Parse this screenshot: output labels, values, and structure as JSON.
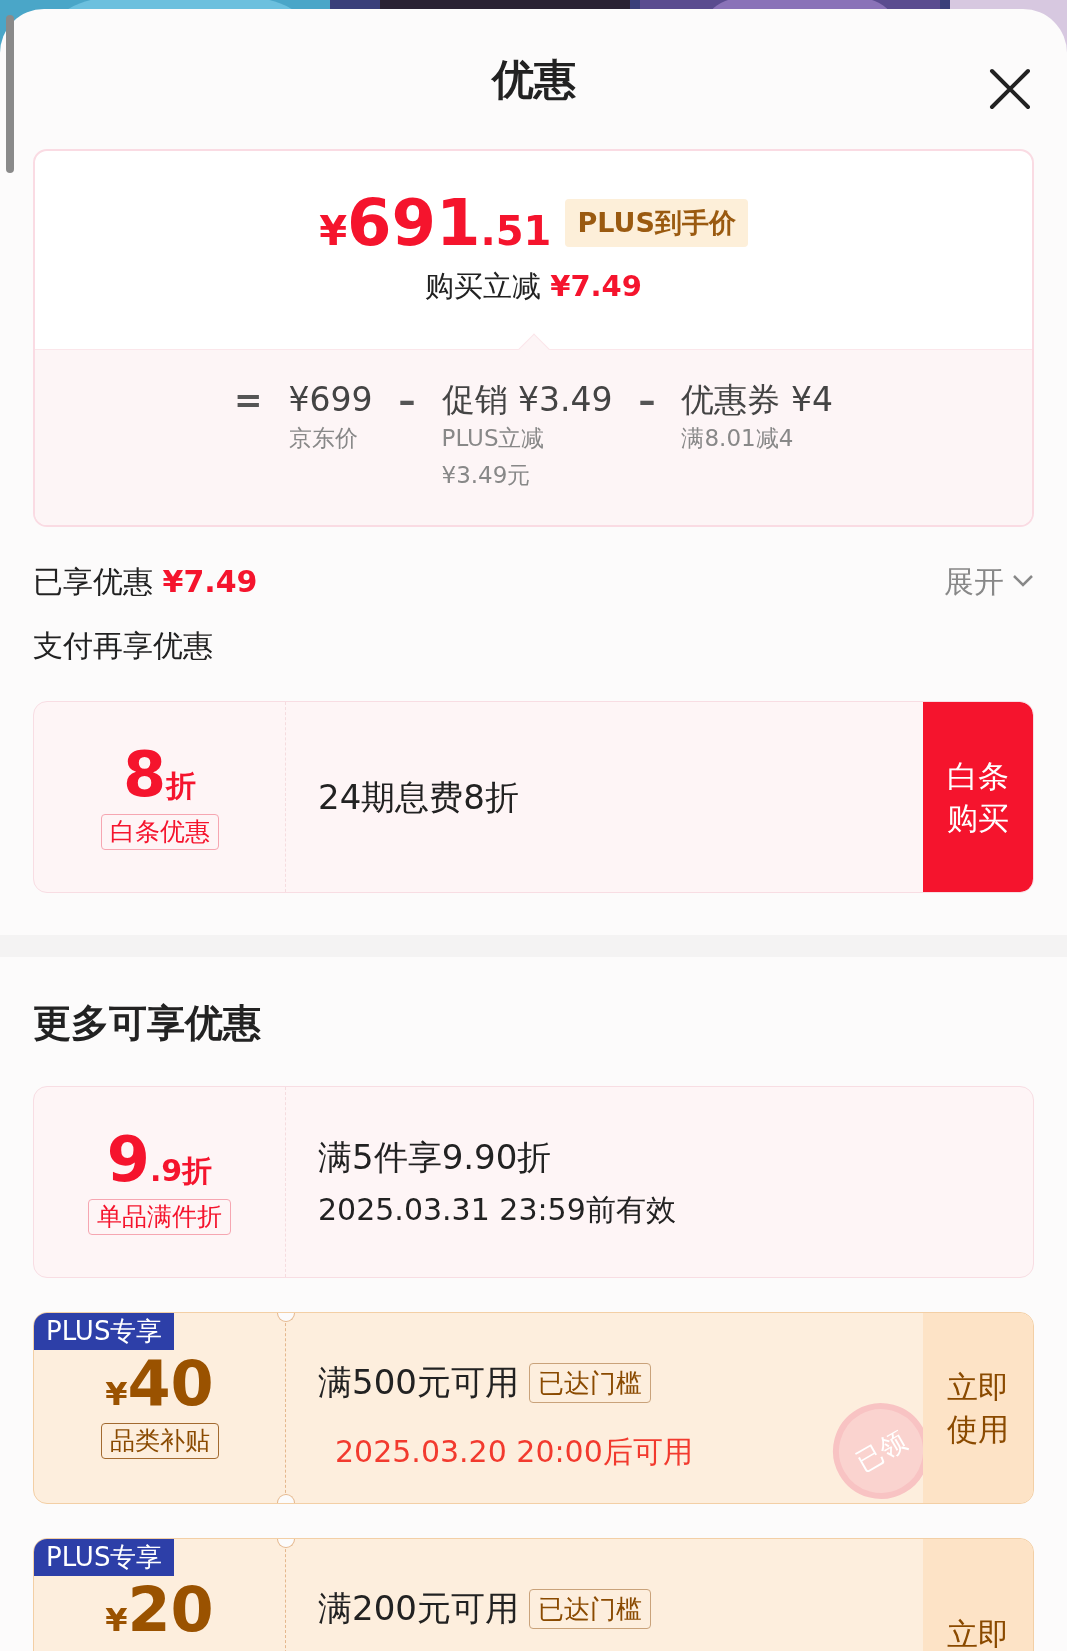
{
  "header": {
    "title": "优惠"
  },
  "price_card": {
    "symbol": "¥",
    "integer": "691",
    "decimal": ".51",
    "tag": "PLUS到手价",
    "saving_label": "购买立减",
    "saving_value": "¥7.49",
    "breakdown": [
      {
        "operator": "=",
        "amount": "¥699",
        "notes": [
          "京东价"
        ]
      },
      {
        "operator": "–",
        "label": "促销",
        "amount": "¥3.49",
        "notes": [
          "PLUS立减",
          "¥3.49元"
        ]
      },
      {
        "operator": "–",
        "label": "优惠券",
        "amount": "¥4",
        "notes": [
          "满8.01减4"
        ]
      }
    ]
  },
  "enjoyed": {
    "label": "已享优惠",
    "value": "¥7.49",
    "toggle": "展开",
    "expanded": false
  },
  "payment_section": {
    "title": "支付再享优惠",
    "offers": [
      {
        "kind": "discount",
        "main": "8",
        "small": "折",
        "tag": "白条优惠",
        "title": "24期息费8折",
        "action": [
          "白条",
          "购买"
        ]
      }
    ]
  },
  "more_section": {
    "title": "更多可享优惠",
    "offers": [
      {
        "kind": "discount",
        "main": "9",
        "small": ".9折",
        "tag": "单品满件折",
        "title": "满5件享9.90折",
        "validity": "2025.03.31 23:59前有效",
        "validity_alert": false
      },
      {
        "kind": "coupon",
        "badge": "PLUS专享",
        "symbol": "¥",
        "main": "40",
        "tag": "品类补贴",
        "title": "满500元可用",
        "status": "已达门槛",
        "validity": "2025.03.20 20:00后可用",
        "validity_alert": true,
        "action": [
          "立即",
          "使用"
        ],
        "stamp": "已领"
      },
      {
        "kind": "coupon",
        "badge": "PLUS专享",
        "symbol": "¥",
        "main": "20",
        "title": "满200元可用",
        "status": "已达门槛",
        "action": [
          "立即"
        ]
      }
    ]
  }
}
